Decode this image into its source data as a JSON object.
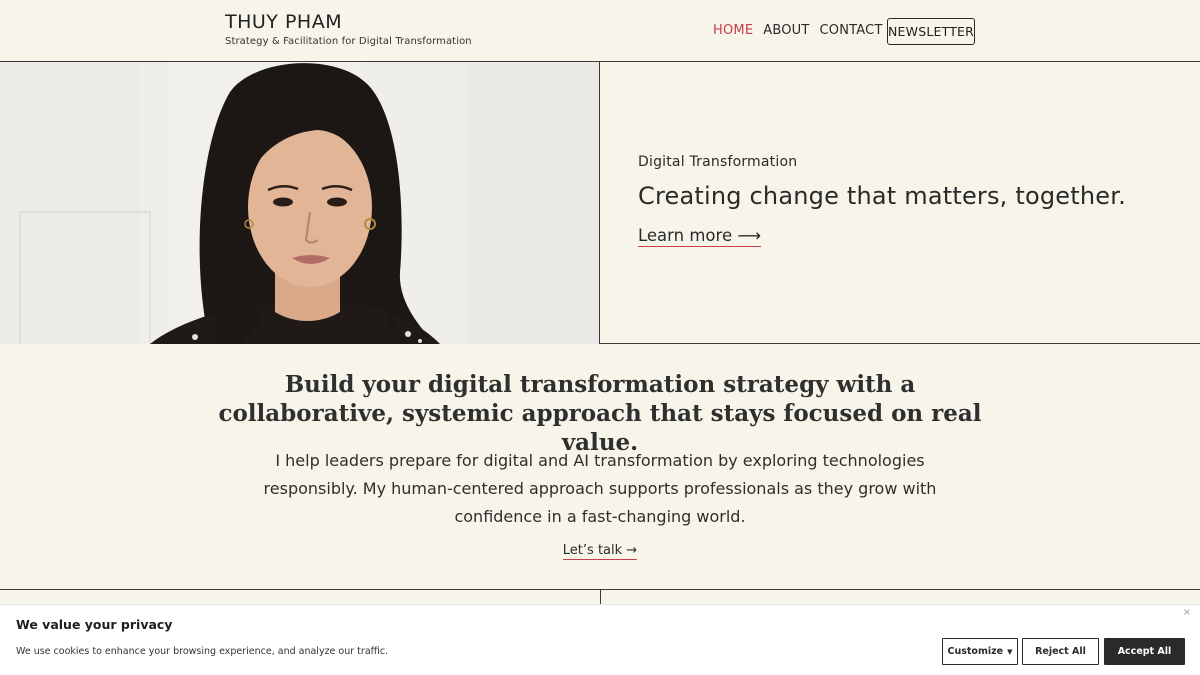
{
  "header": {
    "brand_name": "THUY PHAM",
    "brand_tagline": "Strategy & Facilitation for Digital Transformation",
    "nav": [
      {
        "label": "HOME",
        "active": true
      },
      {
        "label": "ABOUT",
        "active": false
      },
      {
        "label": "CONTACT",
        "active": false
      }
    ],
    "newsletter_label": "NEWSLETTER",
    "accent_color": "#c83c4e"
  },
  "hero": {
    "kicker": "Digital Transformation",
    "title": "Creating change that matters, together.",
    "link_label": "Learn more",
    "link_arrow": "⟶",
    "image_icon": "portrait-photo"
  },
  "intro": {
    "heading": "Build your digital transformation strategy with a collaborative, systemic approach that stays focused on real value.",
    "body": "I help leaders prepare for digital and AI transformation by exploring technologies responsibly. My human-centered approach supports professionals as they grow with confidence in a fast-changing world.",
    "link_label": "Let’s talk",
    "link_arrow": "→"
  },
  "cookie_banner": {
    "title": "We value your privacy",
    "text": "We use cookies to enhance your browsing experience, and analyze our traffic.",
    "close_icon": "×",
    "customize_label": "Customize",
    "customize_caret": "▼",
    "reject_label": "Reject All",
    "accept_label": "Accept All"
  }
}
